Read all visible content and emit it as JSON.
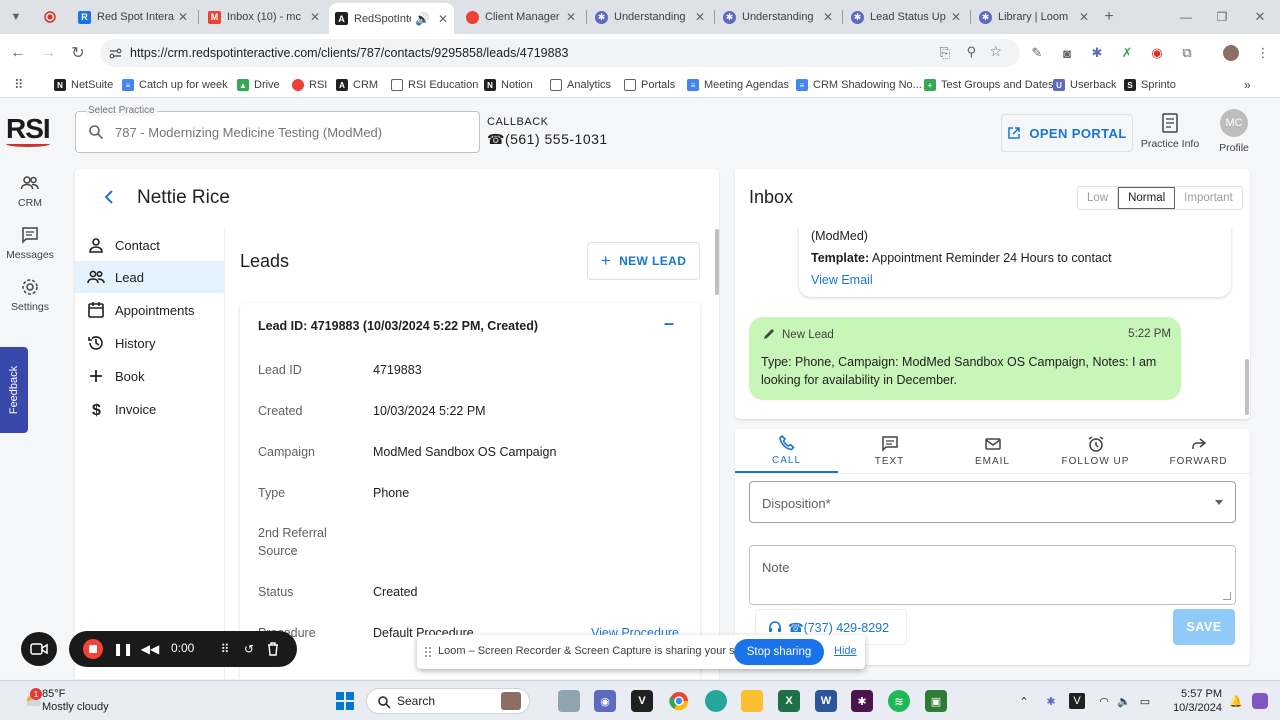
{
  "browser": {
    "tabs": [
      {
        "label": "Red Spot Intera",
        "favicon_color": "#1a73e8"
      },
      {
        "label": "Inbox (10) - mc",
        "favicon_color": "#ea4335"
      },
      {
        "label": "RedSpotInter",
        "favicon_color": "#212121",
        "active": true
      },
      {
        "label": "Client Manager",
        "favicon_color": "#ea4335"
      },
      {
        "label": "Understanding",
        "favicon_color": "#5c6bc0"
      },
      {
        "label": "Understanding",
        "favicon_color": "#5c6bc0"
      },
      {
        "label": "Lead Status Up",
        "favicon_color": "#5c6bc0"
      },
      {
        "label": "Library | Loom",
        "favicon_color": "#5c6bc0"
      }
    ],
    "url": "https://crm.redspotinteractive.com/clients/787/contacts/9295858/leads/4719883",
    "bookmarks": [
      {
        "label": "NetSuite",
        "color": "#212121"
      },
      {
        "label": "Catch up for week",
        "color": "#4285f4"
      },
      {
        "label": "Drive",
        "color": "#34a853"
      },
      {
        "label": "RSI",
        "color": "#ea4335"
      },
      {
        "label": "CRM",
        "color": "#212121"
      },
      {
        "label": "RSI Education",
        "color": "#5f6368"
      },
      {
        "label": "Notion",
        "color": "#212121"
      },
      {
        "label": "Analytics",
        "color": "#5f6368"
      },
      {
        "label": "Portals",
        "color": "#5f6368"
      },
      {
        "label": "Meeting Agendas",
        "color": "#4285f4"
      },
      {
        "label": "CRM Shadowing No...",
        "color": "#4285f4"
      },
      {
        "label": "Test Groups and Dates",
        "color": "#34a853"
      },
      {
        "label": "Userback",
        "color": "#5c6bc0"
      },
      {
        "label": "Sprinto",
        "color": "#212121"
      }
    ]
  },
  "app": {
    "logo": "RSI",
    "nav": [
      {
        "label": "CRM",
        "icon": "people-icon"
      },
      {
        "label": "Messages",
        "icon": "chat-icon"
      },
      {
        "label": "Settings",
        "icon": "gear-icon"
      }
    ],
    "feedback": "Feedback",
    "practice_select": {
      "label": "Select Practice",
      "value": "787 - Modernizing Medicine Testing (ModMed)"
    },
    "callback": {
      "label": "CALLBACK",
      "number": "☎(561) 555-1031"
    },
    "open_portal": "OPEN PORTAL",
    "practice_info": "Practice Info",
    "profile": {
      "initials": "MC",
      "label": "Profile"
    }
  },
  "contact": {
    "name": "Nettie Rice",
    "tabs": [
      {
        "label": "Contact",
        "icon": "person-icon"
      },
      {
        "label": "Lead",
        "icon": "people-icon",
        "active": true
      },
      {
        "label": "Appointments",
        "icon": "calendar-icon"
      },
      {
        "label": "History",
        "icon": "history-icon"
      },
      {
        "label": "Book",
        "icon": "plus-icon"
      },
      {
        "label": "Invoice",
        "icon": "dollar-icon"
      }
    ],
    "leads": {
      "title": "Leads",
      "new_lead": "NEW LEAD",
      "card_title": "Lead ID: 4719883 (10/03/2024 5:22 PM, Created)",
      "fields": [
        {
          "key": "Lead ID",
          "value": "4719883"
        },
        {
          "key": "Created",
          "value": "10/03/2024 5:22 PM"
        },
        {
          "key": "Campaign",
          "value": "ModMed Sandbox OS Campaign"
        },
        {
          "key": "Type",
          "value": "Phone"
        },
        {
          "key": "2nd Referral Source",
          "value": ""
        },
        {
          "key": "Status",
          "value": "Created"
        },
        {
          "key": "Procedure",
          "value": "Default Procedure",
          "link": "View Procedure"
        }
      ]
    }
  },
  "inbox": {
    "title": "Inbox",
    "priorities": [
      "Low",
      "Normal",
      "Important"
    ],
    "active_priority": "Normal",
    "email_message": {
      "line1": "(ModMed)",
      "template_label": "Template:",
      "template_value": " Appointment Reminder 24 Hours to contact",
      "link": "View Email"
    },
    "new_lead_message": {
      "title": "New Lead",
      "time": "5:22 PM",
      "body": "Type: Phone, Campaign: ModMed Sandbox OS Campaign, Notes: I am looking for availability in December."
    }
  },
  "actions": {
    "tabs": [
      {
        "label": "CALL",
        "icon": "phone-icon",
        "active": true
      },
      {
        "label": "TEXT",
        "icon": "message-icon"
      },
      {
        "label": "EMAIL",
        "icon": "mail-icon"
      },
      {
        "label": "FOLLOW UP",
        "icon": "alarm-icon"
      },
      {
        "label": "FORWARD",
        "icon": "forward-icon"
      }
    ],
    "disposition_label": "Disposition*",
    "note_label": "Note",
    "phone": "☎(737) 429-8292",
    "save": "SAVE"
  },
  "loom": {
    "time": "0:00",
    "sharing_text": "Loom – Screen Recorder & Screen Capture is sharing your screen.",
    "stop_sharing": "Stop sharing",
    "hide": "Hide"
  },
  "taskbar": {
    "weather_badge": "1",
    "temperature": "85°F",
    "condition": "Mostly cloudy",
    "search": "Search",
    "time": "5:57 PM",
    "date": "10/3/2024"
  },
  "colors": {
    "accent": "#1976d2",
    "new_lead_bubble": "#c8f5b8",
    "save_disabled": "#90caf9",
    "loom_stop": "#f44336"
  }
}
